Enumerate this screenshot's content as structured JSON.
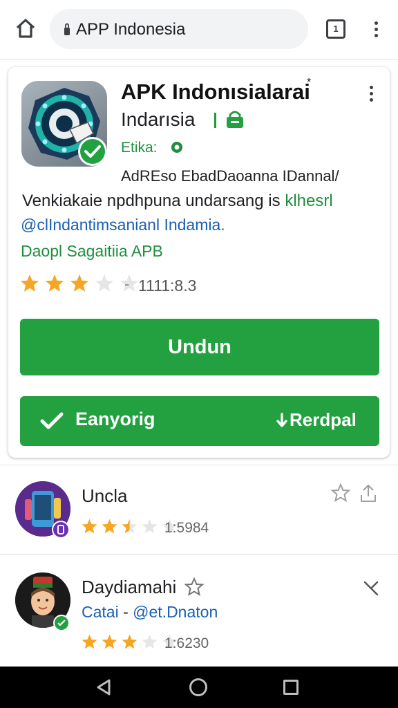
{
  "browser": {
    "url_text": "APP Indonesia",
    "tab_count": "1",
    "icons": {
      "home": "home-icon",
      "lock": "lock-icon",
      "tabs": "tabs-icon",
      "menu": "more-vert-icon"
    }
  },
  "featured_app": {
    "title": "APK Indonısialarai",
    "title_mark": "*",
    "developer": "Indarısia",
    "meta_label": "Etika:",
    "description_1": "AdREso EbadDaoanna IDannal/",
    "description_2_main": "Venkiakaie npdhpuna undarsang is",
    "description_2_highlight": "klhesrl",
    "description_3": "@clIndantimsanianl Indamia.",
    "description_4": "Daopl Sagaitiia APB",
    "rating": 3,
    "rating_max": 5,
    "rating_separator": "-",
    "rating_count": "1111:8.3",
    "primary_button": "Undun",
    "secondary_button_left": "Eanyorig",
    "secondary_button_right": "Rerdpal"
  },
  "list": [
    {
      "title": "Uncla",
      "rating": 2.5,
      "rating_count": "1:5984"
    },
    {
      "title": "Daydiamahi",
      "subtitle_left": "Catai",
      "subtitle_sep": "-",
      "subtitle_right": "@et.Dnaton",
      "rating": 3,
      "rating_count": "1:6230"
    }
  ],
  "colors": {
    "accent_green": "#23a140",
    "link_blue": "#1a5fb4",
    "star_gold": "#f5a623"
  }
}
